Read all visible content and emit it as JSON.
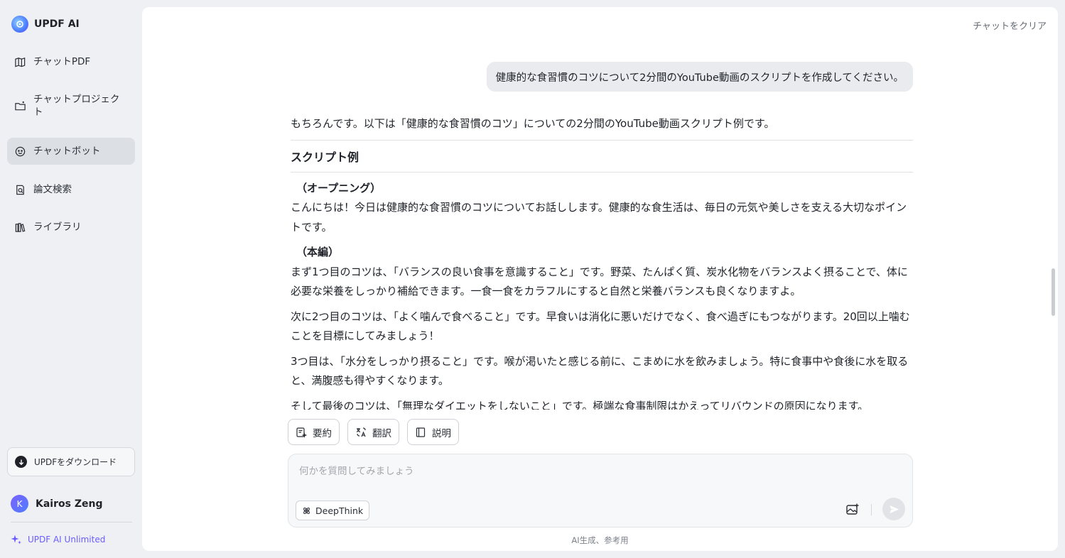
{
  "brand": {
    "name": "UPDF AI"
  },
  "sidebar": {
    "items": [
      {
        "label": "チャットPDF",
        "icon": "chat-pdf-icon"
      },
      {
        "label": "チャットプロジェクト",
        "icon": "folder-icon"
      },
      {
        "label": "チャットボット",
        "icon": "chatbot-icon",
        "active": true
      },
      {
        "label": "論文検索",
        "icon": "paper-search-icon"
      },
      {
        "label": "ライブラリ",
        "icon": "library-icon"
      }
    ],
    "download_label": "UPDFをダウンロード",
    "user": {
      "initial": "K",
      "name": "Kairos Zeng"
    },
    "plan_label": "UPDF AI Unlimited"
  },
  "header": {
    "clear_label": "チャットをクリア"
  },
  "conversation": {
    "user_message": "健康的な食習慣のコツについて2分間のYouTube動画のスクリプトを作成してください。",
    "answer": {
      "intro": "もちろんです。以下は「健康的な食習慣のコツ」についての2分間のYouTube動画スクリプト例です。",
      "title": "スクリプト例",
      "opening_head": "（オープニング）",
      "opening_text": "こんにちは！今日は健康的な食習慣のコツについてお話しします。健康的な食生活は、毎日の元気や美しさを支える大切なポイントです。",
      "main_head": "（本編）",
      "para1": "まず1つ目のコツは、「バランスの良い食事を意識すること」です。野菜、たんぱく質、炭水化物をバランスよく摂ることで、体に必要な栄養をしっかり補給できます。一食一食をカラフルにすると自然と栄養バランスも良くなりますよ。",
      "para2": "次に2つ目のコツは、「よく噛んで食べること」です。早食いは消化に悪いだけでなく、食べ過ぎにもつながります。20回以上噛むことを目標にしてみましょう！",
      "para3": "3つ目は、「水分をしっかり摂ること」です。喉が渇いたと感じる前に、こまめに水を飲みましょう。特に食事中や食後に水を取ると、満腹感も得やすくなります。",
      "para4": "そして最後のコツは、「無理なダイエットをしないこと」です。極端な食事制限はかえってリバウンドの原因になります。"
    }
  },
  "actions": {
    "summarize": "要約",
    "translate": "翻訳",
    "explain": "説明"
  },
  "input": {
    "placeholder": "何かを質問してみましょう",
    "deepthink_label": "DeepThink"
  },
  "footer": {
    "note": "AI生成、参考用"
  }
}
